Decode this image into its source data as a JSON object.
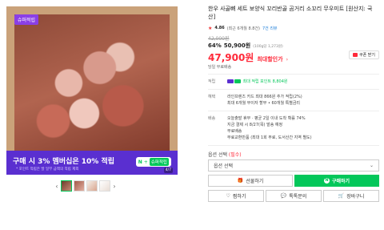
{
  "gallery": {
    "exclusive_badge": "슈퍼적립",
    "banner_title": "구매 시 3% 멤버십은 10% 적립",
    "banner_sub": "* 포인트 적립은 발 일부 금액의 적립 제외",
    "banner_n": "N",
    "banner_plus": "+",
    "banner_super": "슈퍼적립",
    "banner_count": "4/7",
    "prev_arrow": "‹",
    "next_arrow": "›"
  },
  "product": {
    "title": "한우 사골뼈 세트 보양식 꼬리반골 곰거리 소꼬리 무우미트 [원산지: 국산]",
    "rating_star": "★",
    "rating_score": "4.86",
    "rating_count": "(최근 6개월 8.8건)",
    "review_link": "7건 리뷰",
    "original_price": "42,000원",
    "discount_pct": "64%",
    "discount_price": "50,900원",
    "unit_price": "(100g당 1,273원)",
    "final_price": "47,900원",
    "final_label": "최대할인가",
    "final_chev": "›",
    "coupon_label": "쿠폰 받기",
    "ship_note": "당일 무료배송"
  },
  "benefits": {
    "points_label": "적립",
    "points_value": "최대 적립 포인트 8,804원",
    "card_label": "혜택",
    "card_line1": "라인프렌즈 카드 최대 866원 추가 적립(2%)",
    "card_line2": "최대 6개월 무이자 할부 • 60개월 특별금리",
    "ship_label": "배송",
    "ship_line1": "오늘출발 휴무 · 평균 2일 이내 도착 확률 74%",
    "ship_line2": "지금 결제 시 8/27(목) 발송 예정",
    "ship_line3": "무료배송",
    "ship_line4": "무료교환반품 (최대 1회 무료, 도서산간 지역 별도)"
  },
  "options": {
    "label": "옵션 선택",
    "required": "(필수)",
    "select_value": "옵션 선택",
    "chevron": "⌄"
  },
  "actions": {
    "gift_label": "선물하기",
    "buy_label": "구매하기",
    "wish_label": "찜하기",
    "talk_label": "톡톡문의",
    "cart_label": "장바구니"
  },
  "colors": {
    "accent_green": "#03c75a",
    "price_red": "#ff2a3a",
    "banner_purple": "#5a2fd0"
  }
}
